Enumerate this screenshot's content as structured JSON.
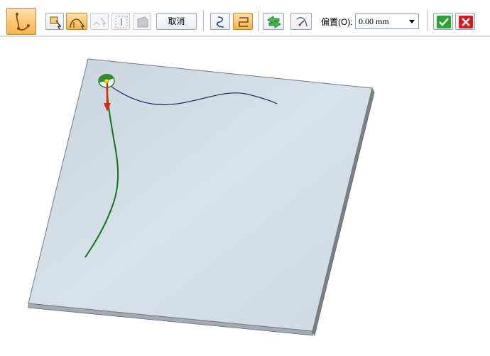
{
  "toolbar": {
    "buttons": [
      {
        "name": "chain-select-button",
        "icon": "chain-icon",
        "active": true
      },
      {
        "name": "select-face-button",
        "icon": "face-select-icon"
      },
      {
        "name": "select-curve-button",
        "icon": "curve-select-icon",
        "active": true
      },
      {
        "name": "select-two-point-button",
        "icon": "two-point-icon",
        "disabled": true
      },
      {
        "name": "select-box-button",
        "icon": "box-select-icon",
        "disabled": true
      },
      {
        "name": "select-region-button",
        "icon": "region-select-icon",
        "disabled": true
      },
      {
        "name": "curve-mode-open-button",
        "icon": "open-curve-icon"
      },
      {
        "name": "curve-mode-closed-button",
        "icon": "closed-curve-icon",
        "active": true
      },
      {
        "name": "flip-direction-button",
        "icon": "flip-arrows-icon"
      },
      {
        "name": "side-step-button",
        "icon": "side-step-icon"
      },
      {
        "name": "accept-button",
        "icon": "check-icon"
      },
      {
        "name": "cancel-x-button",
        "icon": "close-icon"
      }
    ],
    "cancel_label": "取消",
    "offset_label": "偏置(O):",
    "offset_value": "0.00 mm"
  },
  "colors": {
    "active_fill": "#f6b24a",
    "plate_top": "#d2dce4",
    "plate_edge": "#8e949c",
    "green_curve": "#0d7a1a",
    "blue_curve": "#2a2f6e",
    "arrow_red": "#e0281b",
    "accept_green": "#2aa52f",
    "cancel_red": "#d61a1a"
  }
}
